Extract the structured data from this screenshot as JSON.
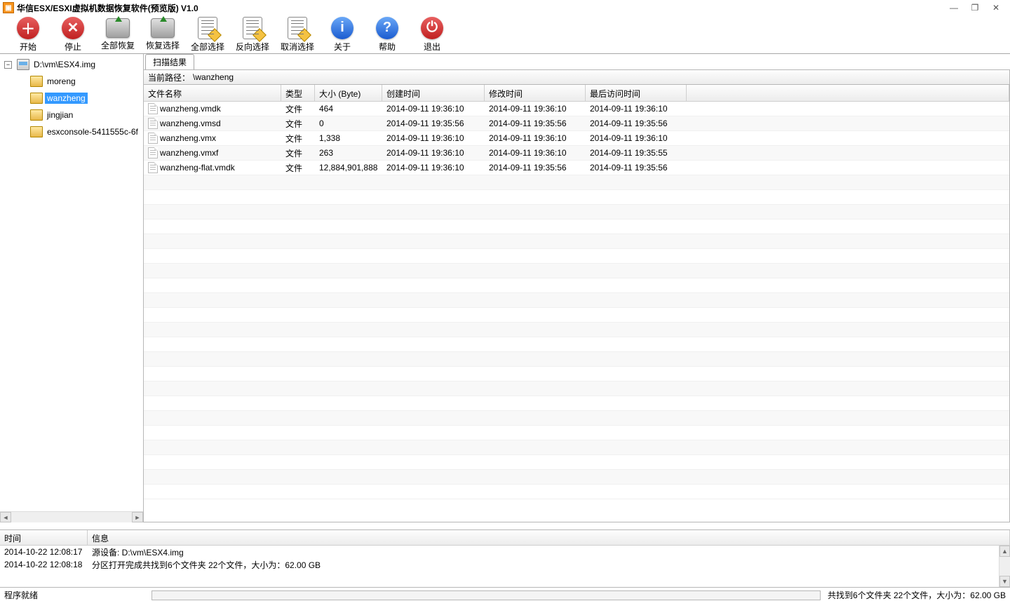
{
  "window": {
    "title": "华信ESX/ESXI虚拟机数据恢复软件(预览版) V1.0"
  },
  "toolbar": {
    "start": "开始",
    "stop": "停止",
    "recover_all": "全部恢复",
    "recover_sel": "恢复选择",
    "select_all": "全部选择",
    "invert_sel": "反向选择",
    "clear_sel": "取消选择",
    "about": "关于",
    "help": "帮助",
    "exit": "退出"
  },
  "tree": {
    "root": "D:\\vm\\ESX4.img",
    "children": [
      {
        "label": "moreng"
      },
      {
        "label": "wanzheng",
        "selected": true
      },
      {
        "label": "jingjian"
      },
      {
        "label": "esxconsole-5411555c-6f"
      }
    ]
  },
  "tab": {
    "label": "扫描结果"
  },
  "pathbar": {
    "label": "当前路径：",
    "value": "\\wanzheng"
  },
  "columns": {
    "name": "文件名称",
    "type": "类型",
    "size": "大小 (Byte)",
    "ctime": "创建时间",
    "mtime": "修改时间",
    "atime": "最后访问时间"
  },
  "files": [
    {
      "name": "wanzheng.vmdk",
      "type": "文件",
      "size": "464",
      "ct": "2014-09-11 19:36:10",
      "mt": "2014-09-11 19:36:10",
      "at": "2014-09-11 19:36:10"
    },
    {
      "name": "wanzheng.vmsd",
      "type": "文件",
      "size": "0",
      "ct": "2014-09-11 19:35:56",
      "mt": "2014-09-11 19:35:56",
      "at": "2014-09-11 19:35:56"
    },
    {
      "name": "wanzheng.vmx",
      "type": "文件",
      "size": "1,338",
      "ct": "2014-09-11 19:36:10",
      "mt": "2014-09-11 19:36:10",
      "at": "2014-09-11 19:36:10"
    },
    {
      "name": "wanzheng.vmxf",
      "type": "文件",
      "size": "263",
      "ct": "2014-09-11 19:36:10",
      "mt": "2014-09-11 19:36:10",
      "at": "2014-09-11 19:35:55"
    },
    {
      "name": "wanzheng-flat.vmdk",
      "type": "文件",
      "size": "12,884,901,888",
      "ct": "2014-09-11 19:36:10",
      "mt": "2014-09-11 19:35:56",
      "at": "2014-09-11 19:35:56"
    }
  ],
  "log": {
    "columns": {
      "time": "时间",
      "msg": "信息"
    },
    "rows": [
      {
        "t": "2014-10-22 12:08:17",
        "m": "源设备: D:\\vm\\ESX4.img"
      },
      {
        "t": "2014-10-22 12:08:18",
        "m": "分区打开完成共找到6个文件夹 22个文件，大小为：62.00 GB"
      }
    ]
  },
  "status": {
    "left": "程序就绪",
    "right": "共找到6个文件夹 22个文件，大小为：62.00 GB"
  }
}
